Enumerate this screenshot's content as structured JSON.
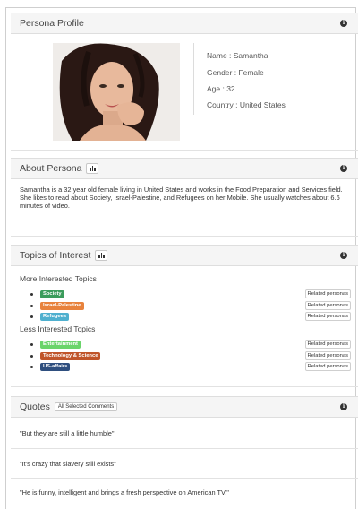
{
  "persona_profile": {
    "title": "Persona Profile",
    "name": "Name : Samantha",
    "gender": "Gender : Female",
    "age": "Age : 32",
    "country": "Country : United States"
  },
  "about": {
    "title": "About Persona",
    "text": "Samantha is a 32 year old female living in United States and works in the Food Preparation and Services field. She likes to read about Society, Israel-Palestine, and Refugees on her Mobile. She usually watches about 6.6 minutes of video."
  },
  "topics": {
    "title": "Topics of Interest",
    "more_label": "More Interested Topics",
    "less_label": "Less Interested Topics",
    "related_label": "Related personas",
    "more": [
      {
        "label": "Society",
        "color": "#3c9c5c"
      },
      {
        "label": "Israel-Palestine",
        "color": "#e8823c"
      },
      {
        "label": "Refugees",
        "color": "#4fb0cf"
      }
    ],
    "less": [
      {
        "label": "Entertainment",
        "color": "#6ad46a"
      },
      {
        "label": "Technology & Science",
        "color": "#c0552a"
      },
      {
        "label": "US-affairs",
        "color": "#2f4f7f"
      }
    ]
  },
  "quotes": {
    "title": "Quotes",
    "filter_label": "All Selected Comments",
    "items": [
      "\"But they are still a little humble\"",
      "\"It's crazy that slavery still exists\"",
      "\"He is funny, intelligent and brings a fresh perspective on American TV.\""
    ]
  },
  "icons": {
    "info": "info-icon",
    "chart": "bar-chart-icon"
  }
}
